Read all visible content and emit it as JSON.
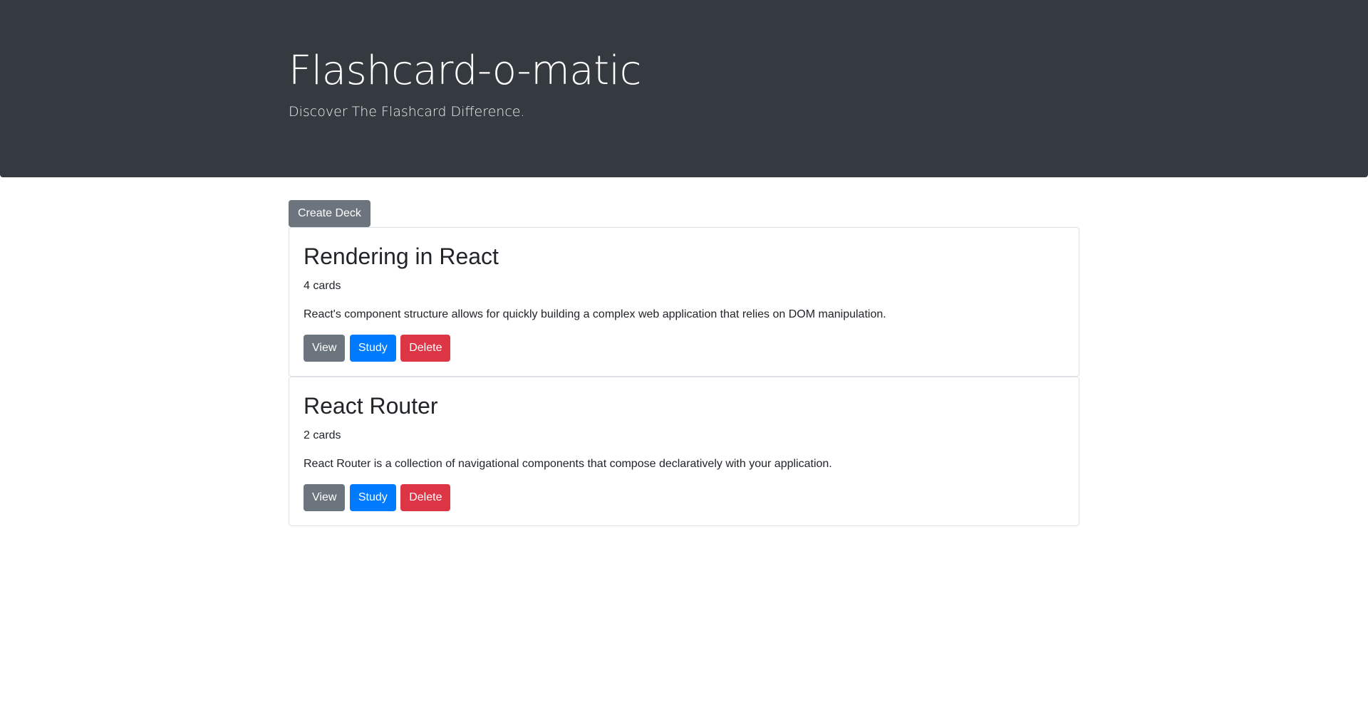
{
  "header": {
    "title": "Flashcard-o-matic",
    "subtitle": "Discover The Flashcard Difference."
  },
  "toolbar": {
    "create_deck_label": "Create Deck"
  },
  "decks": [
    {
      "name": "Rendering in React",
      "card_count": "4 cards",
      "description": "React's component structure allows for quickly building a complex web application that relies on DOM manipulation.",
      "view_label": "View",
      "study_label": "Study",
      "delete_label": "Delete"
    },
    {
      "name": "React Router",
      "card_count": "2 cards",
      "description": "React Router is a collection of navigational components that compose declaratively with your application.",
      "view_label": "View",
      "study_label": "Study",
      "delete_label": "Delete"
    }
  ],
  "colors": {
    "header_bg": "#343a40",
    "secondary": "#6c757d",
    "primary": "#007bff",
    "danger": "#dc3545"
  }
}
